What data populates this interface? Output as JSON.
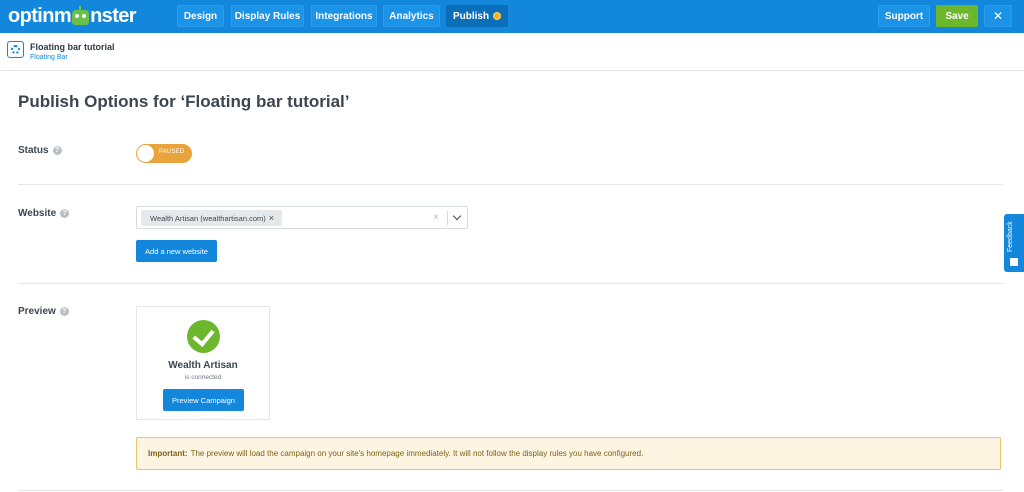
{
  "topbar": {
    "logo_text_left": "optinm",
    "logo_text_right": "nster",
    "tabs": [
      {
        "label": "Design"
      },
      {
        "label": "Display Rules"
      },
      {
        "label": "Integrations"
      },
      {
        "label": "Analytics"
      },
      {
        "label": "Publish"
      }
    ],
    "support_label": "Support",
    "save_label": "Save",
    "close_label": "✕",
    "colors": {
      "bar": "#1287dc",
      "save": "#6cb72c",
      "publish_dot": "#f3b320"
    }
  },
  "campaign": {
    "title": "Floating bar tutorial",
    "type": "Floating Bar"
  },
  "main": {
    "page_title": "Publish Options for ‘Floating bar tutorial’",
    "status": {
      "label": "Status",
      "help": "?",
      "toggle_text": "PAUSED",
      "toggle_color": "#e8a33b"
    },
    "website": {
      "label": "Website",
      "help": "?",
      "selected_chip": "Wealth Artisan (wealthartisan.com)",
      "chip_remove": "×",
      "clear_icon": "×",
      "add_button": "Add a new website"
    },
    "preview": {
      "label": "Preview",
      "help": "?",
      "site_name": "Wealth Artisan",
      "connected_text": "is connected",
      "preview_button": "Preview Campaign"
    },
    "notice": {
      "strong": "Important:",
      "text": "The preview will load the campaign on your site's homepage immediately. It will not follow the display rules you have configured."
    }
  },
  "feedback": {
    "label": "Feedback"
  }
}
